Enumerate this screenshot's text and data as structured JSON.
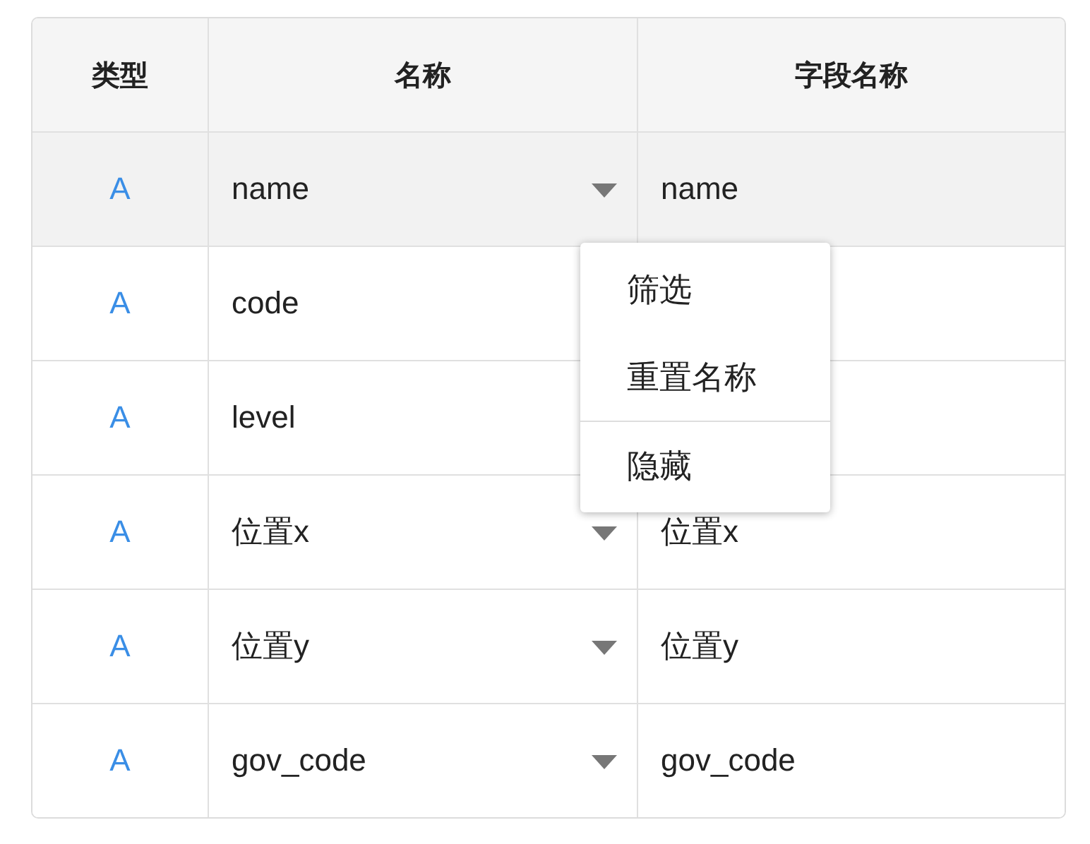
{
  "table": {
    "columns": [
      "类型",
      "名称",
      "字段名称"
    ],
    "rows": [
      {
        "type": "A",
        "name": "name",
        "field_name": "name",
        "selected": true
      },
      {
        "type": "A",
        "name": "code",
        "selected": false
      },
      {
        "type": "A",
        "name": "level",
        "selected": false
      },
      {
        "type": "A",
        "name": "位置x",
        "field_name": "位置x",
        "selected": false
      },
      {
        "type": "A",
        "name": "位置y",
        "field_name": "位置y",
        "selected": false
      },
      {
        "type": "A",
        "name": "gov_code",
        "field_name": "gov_code",
        "selected": false
      }
    ]
  },
  "context_menu": {
    "items": [
      {
        "label": "筛选",
        "divider_before": false
      },
      {
        "label": "重置名称",
        "divider_before": false
      },
      {
        "label": "隐藏",
        "divider_before": true
      }
    ]
  }
}
